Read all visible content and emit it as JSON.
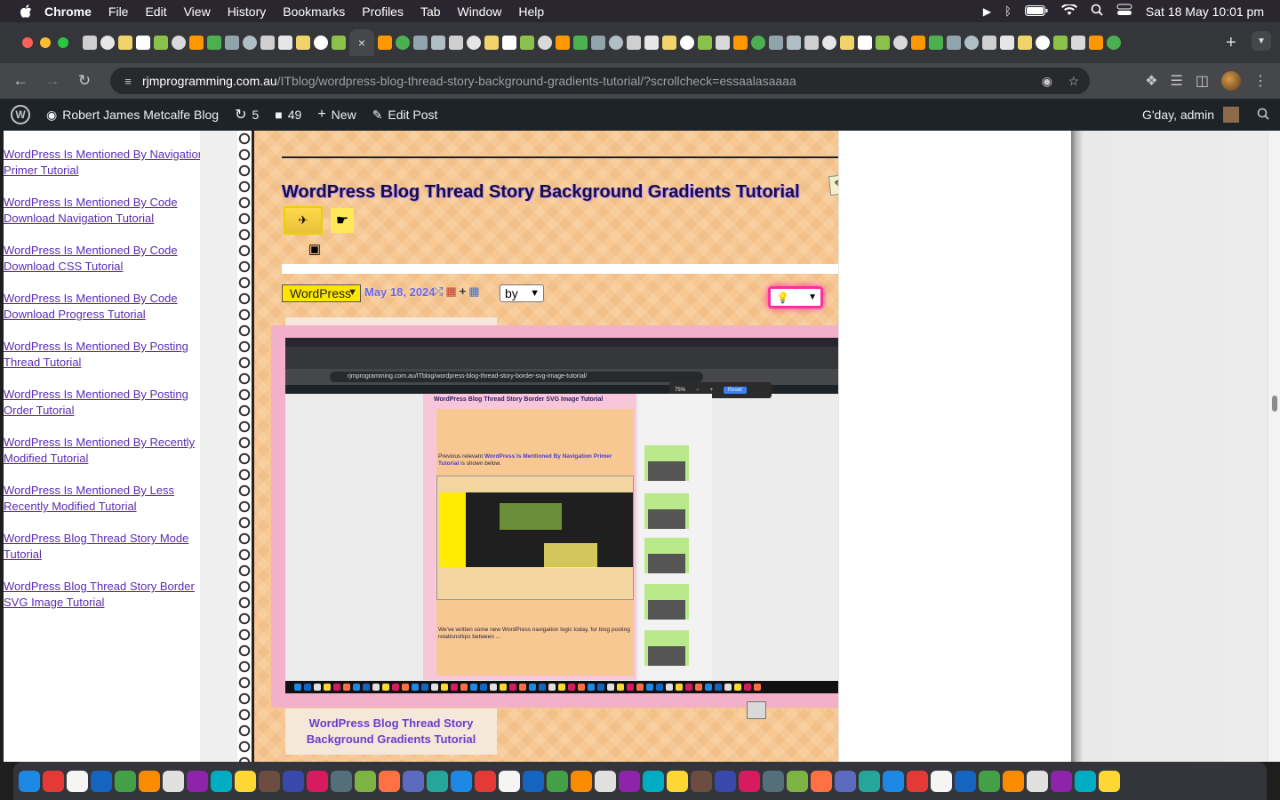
{
  "menubar": {
    "app": "Chrome",
    "items": [
      "File",
      "Edit",
      "View",
      "History",
      "Bookmarks",
      "Profiles",
      "Tab",
      "Window",
      "Help"
    ],
    "datetime": "Sat 18 May  10:01 pm"
  },
  "toolbar": {
    "url_host": "rjmprogramming.com.au",
    "url_path": "/ITblog/wordpress-blog-thread-story-background-gradients-tutorial/?scrollcheck=essaalasaaaa"
  },
  "wpbar": {
    "site_name": "Robert James Metcalfe Blog",
    "updates": "5",
    "comments": "49",
    "new_label": "New",
    "edit_label": "Edit Post",
    "greeting": "G'day, admin"
  },
  "sidebar": {
    "links": [
      "WordPress Is Mentioned By Navigation Primer Tutorial",
      "WordPress Is Mentioned By Code Download Navigation Tutorial",
      "WordPress Is Mentioned By Code Download CSS Tutorial",
      "WordPress Is Mentioned By Code Download Progress Tutorial",
      "WordPress Is Mentioned By Posting Thread Tutorial",
      "WordPress Is Mentioned By Posting Order Tutorial",
      "WordPress Is Mentioned By Recently Modified Tutorial",
      "WordPress Is Mentioned By Less Recently Modified Tutorial",
      "WordPress Blog Thread Story Mode Tutorial",
      "WordPress Blog Thread Story Border SVG Image Tutorial"
    ]
  },
  "post": {
    "title": "WordPress Blog Thread Story Background Gradients Tutorial",
    "category_select": "WordPress",
    "date": "May 18, 2024",
    "by_select": "by",
    "caption": "WordPress Blog Thread Story Background Gradients Tutorial"
  },
  "inner_screenshot": {
    "url": "rjmprogramming.com.au/ITblog/wordpress-blog-thread-story-border-svg-image-tutorial/",
    "zoom": "75%",
    "reset": "Reset",
    "title": "WordPress Blog Thread Story Border SVG Image Tutorial",
    "prev_text_a": "Previous relevant ",
    "prev_text_link": "WordPress Is Mentioned By Navigation Primer Tutorial",
    "prev_text_b": " is shown below.",
    "body": "We've written some new WordPress navigation logic today, for blog posting relationships between ..."
  },
  "colors": {
    "main_bg": "#f7c892",
    "link": "#5a2ea8",
    "date": "#6b64e6",
    "pink_frame": "#f3b0c9"
  }
}
